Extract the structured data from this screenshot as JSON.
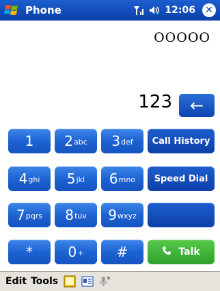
{
  "titlebar": {
    "title": "Phone",
    "time": "12:06",
    "icons": [
      "windows-start-icon",
      "signal-icon",
      "volume-icon",
      "close-icon"
    ]
  },
  "display": {
    "top_number": "OOOOO",
    "dialed": "123",
    "backspace": "←"
  },
  "keypad": {
    "keys": [
      {
        "digit": "1",
        "letters": ""
      },
      {
        "digit": "2",
        "letters": "abc"
      },
      {
        "digit": "3",
        "letters": "def"
      },
      {
        "digit": "4",
        "letters": "ghi"
      },
      {
        "digit": "5",
        "letters": "jkl"
      },
      {
        "digit": "6",
        "letters": "mno"
      },
      {
        "digit": "7",
        "letters": "pqrs"
      },
      {
        "digit": "8",
        "letters": "tuv"
      },
      {
        "digit": "9",
        "letters": "wxyz"
      },
      {
        "digit": "*",
        "letters": ""
      },
      {
        "digit": "0",
        "letters": "+"
      },
      {
        "digit": "#",
        "letters": ""
      }
    ],
    "call_history": "Call History",
    "speed_dial": "Speed Dial",
    "talk": "Talk"
  },
  "menubar": {
    "edit": "Edit",
    "tools": "Tools",
    "icons": [
      "notes-icon",
      "contact-card-icon",
      "microphone-off-icon"
    ]
  },
  "colors": {
    "titlebar": "#0a3fa8",
    "key_blue": "#1e63d3",
    "key_func": "#0c3fa6",
    "talk_green": "#2fa12b",
    "menubar": "#e6e3dc"
  }
}
